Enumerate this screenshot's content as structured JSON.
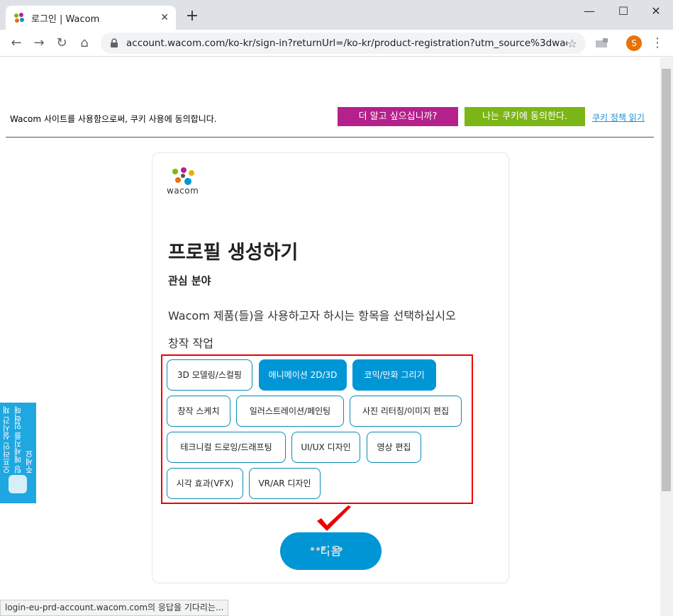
{
  "browser": {
    "tab_title": "로그인 | Wacom",
    "new_tab": "+",
    "url": "account.wacom.com/ko-kr/sign-in?returnUrl=/ko-kr/product-registration?utm_source%3dwaco...",
    "avatar_letter": "S",
    "status_text": "login-eu-prd-account.wacom.com의 응답을 기다리는..."
  },
  "cookie_banner": {
    "message": "Wacom 사이트를 사용함으로써, 쿠키 사용에 동의합니다.",
    "learn_more": "더 알고 싶으십니까?",
    "accept": "나는 쿠키에 동의한다.",
    "policy_link": "쿠키 정책 읽기"
  },
  "card": {
    "logo_text": "wacom",
    "title": "프로필 생성하기",
    "subtitle": "관심 분야",
    "description": "Wacom 제품(들)을 사용하고자 하시는 항목을 선택하십시오",
    "category": "창작 작업",
    "options": [
      {
        "label": "3D 모델링/스컬핑",
        "selected": false
      },
      {
        "label": "애니메이션 2D/3D",
        "selected": true
      },
      {
        "label": "코믹/만화 그리기",
        "selected": true
      },
      {
        "label": "창작 스케치",
        "selected": false
      },
      {
        "label": "일러스트레이션/페인팅",
        "selected": false
      },
      {
        "label": "사진 리터칭/이미지 편집",
        "selected": false
      },
      {
        "label": "테크니컬 드로잉/드래프팅",
        "selected": false
      },
      {
        "label": "UI/UX 디자인",
        "selected": false
      },
      {
        "label": "영상 편집",
        "selected": false
      },
      {
        "label": "시각 효과(VFX)",
        "selected": false
      },
      {
        "label": "VR/AR 디자인",
        "selected": false
      }
    ],
    "next_button": "다음"
  },
  "chat_widget": {
    "label": "오프라인 실시간 채팅 메세지를 입력해주세요"
  },
  "colors": {
    "accent": "#0096d6",
    "magenta": "#b5218b",
    "green": "#7cb516",
    "highlight_red": "#e00000"
  }
}
